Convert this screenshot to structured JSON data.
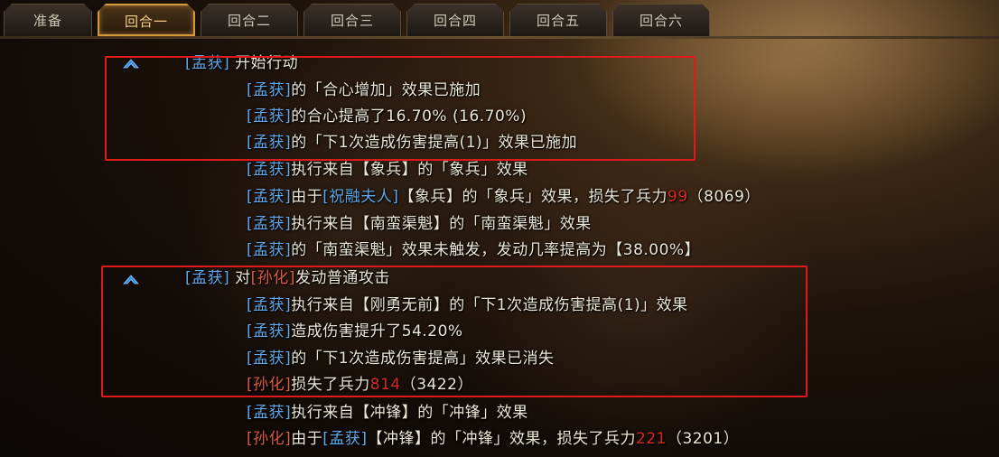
{
  "tabs": [
    "准备",
    "回合一",
    "回合二",
    "回合三",
    "回合四",
    "回合五",
    "回合六"
  ],
  "active_tab": "回合一",
  "colors": {
    "ally_name": "#62a8e8",
    "enemy_name": "#e05a3c",
    "damage_number": "#d82b1e",
    "highlight": "#e01a1a",
    "tab_active": "#d49a3a"
  },
  "icons": {
    "expand": "chevron-up-icon"
  },
  "names": {
    "ally": "孟获",
    "enemy": "孙化"
  },
  "log": {
    "l1": {
      "a": "[孟获]",
      "b": " 开始行动"
    },
    "l2": {
      "a": "[孟获]",
      "b": "的「合心增加」效果已施加"
    },
    "l3": {
      "a": "[孟获]",
      "b": "的合心提高了16.70% (16.70%)"
    },
    "l4": {
      "a": "[孟获]",
      "b": "的「下1次造成伤害提高(1)」效果已施加"
    },
    "l5": {
      "a": "[孟获]",
      "b": "执行来自【象兵】的「象兵」效果"
    },
    "l6": {
      "a": "[孟获]",
      "b": "由于",
      "c": "[祝融夫人]",
      "d": "【象兵】的「象兵」效果，损失了兵力",
      "e": "99",
      "f": "（8069）"
    },
    "l7": {
      "a": "[孟获]",
      "b": "执行来自【南蛮渠魁】的「南蛮渠魁」效果"
    },
    "l8": {
      "a": "[孟获]",
      "b": "的「南蛮渠魁」效果未触发，发动几率提高为【38.00%】"
    },
    "l9": {
      "a": "[孟获]",
      "b": " 对",
      "c": "[孙化]",
      "d": "发动普通攻击"
    },
    "l10": {
      "a": "[孟获]",
      "b": "执行来自【刚勇无前】的「下1次造成伤害提高(1)」效果"
    },
    "l11": {
      "a": "[孟获]",
      "b": "造成伤害提升了54.20%"
    },
    "l12": {
      "a": "[孟获]",
      "b": "的「下1次造成伤害提高」效果已消失"
    },
    "l13": {
      "a": "[孙化]",
      "b": "损失了兵力",
      "e": "814",
      "f": "（3422）"
    },
    "l14": {
      "a": "[孟获]",
      "b": "执行来自【冲锋】的「冲锋」效果"
    },
    "l15": {
      "a": "[孙化]",
      "b": "由于",
      "c": "[孟获]",
      "d": "【冲锋】的「冲锋」效果，损失了兵力",
      "e": "221",
      "f": "（3201）"
    }
  }
}
